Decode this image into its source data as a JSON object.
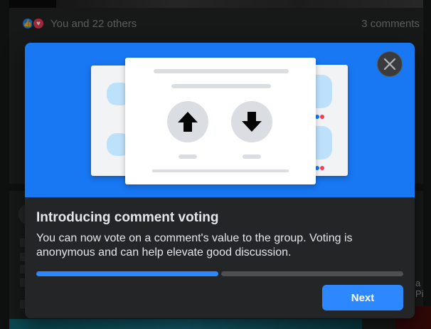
{
  "feed": {
    "reactions_text": "You and 22 others",
    "comments_count": "3 comments",
    "like_glyph": "👍",
    "love_glyph": "♥",
    "right_fragment": "a Pi"
  },
  "modal": {
    "title": "Introducing comment voting",
    "body": "You can now vote on a comment's value to the group. Voting is anonymous and can help elevate good discussion.",
    "next_label": "Next",
    "progress": {
      "current_step": 1,
      "total_steps": 2
    },
    "close_icon": "close-icon",
    "upvote_icon": "arrow-up-icon",
    "downvote_icon": "arrow-down-icon"
  },
  "colors": {
    "accent": "#2d88ff",
    "hero_blue": "#1877f2",
    "surface": "#242526",
    "background": "#18191a"
  }
}
